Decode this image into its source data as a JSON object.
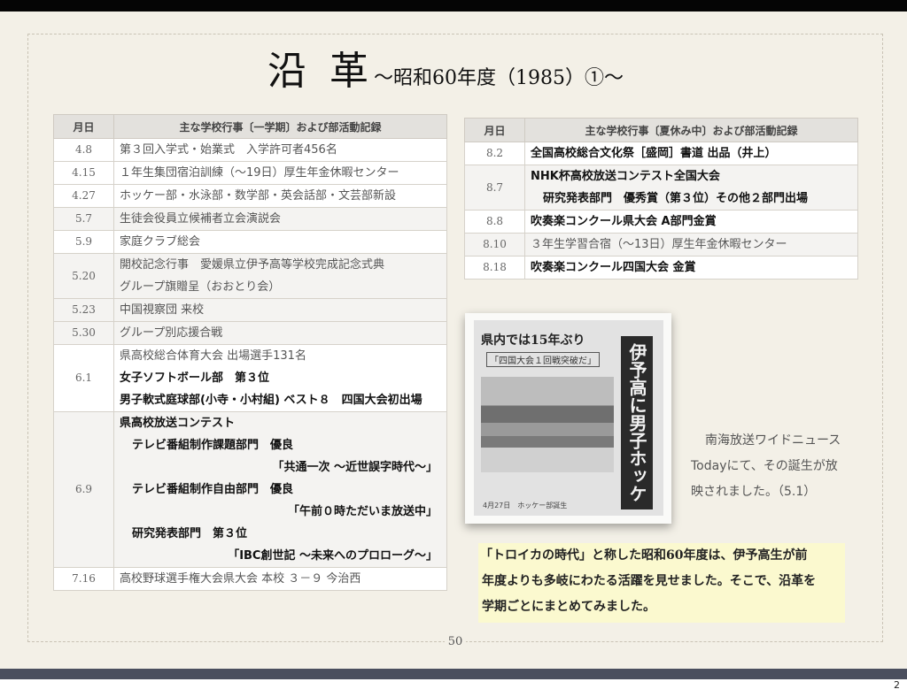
{
  "title": {
    "main": "沿 革",
    "sub": "～昭和60年度（1985）①～"
  },
  "left_table": {
    "headers": [
      "月日",
      "主な学校行事〔一学期〕および部活動記録"
    ],
    "rows": [
      {
        "date": "4.8",
        "shade": false,
        "lines": [
          {
            "text": "第３回入学式・始業式　入学許可者456名"
          }
        ]
      },
      {
        "date": "4.15",
        "shade": false,
        "lines": [
          {
            "text": "１年生集団宿泊訓練（～19日）厚生年金休暇センター"
          }
        ]
      },
      {
        "date": "4.27",
        "shade": false,
        "lines": [
          {
            "text": "ホッケー部・水泳部・数学部・英会話部・文芸部新設"
          }
        ]
      },
      {
        "date": "5.7",
        "shade": true,
        "lines": [
          {
            "text": "生徒会役員立候補者立会演説会"
          }
        ]
      },
      {
        "date": "5.9",
        "shade": false,
        "lines": [
          {
            "text": "家庭クラブ総会"
          }
        ]
      },
      {
        "date": "5.20",
        "shade": true,
        "lines": [
          {
            "text": "開校記念行事　愛媛県立伊予高等学校完成記念式典"
          },
          {
            "text": "グループ旗贈呈（おおとり会）"
          }
        ]
      },
      {
        "date": "5.23",
        "shade": true,
        "lines": [
          {
            "text": "中国視察団 来校"
          }
        ]
      },
      {
        "date": "5.30",
        "shade": true,
        "lines": [
          {
            "text": "グループ別応援合戦"
          }
        ]
      },
      {
        "date": "6.1",
        "shade": false,
        "lines": [
          {
            "text": "県高校総合体育大会 出場選手131名"
          },
          {
            "text": "女子ソフトボール部　第３位",
            "bold": true
          },
          {
            "text": "男子軟式庭球部(小寺・小村組) ベスト８　四国大会初出場",
            "bold": true
          }
        ]
      },
      {
        "date": "6.9",
        "shade": true,
        "lines": [
          {
            "text": "県高校放送コンテスト",
            "bold": true
          },
          {
            "text": "テレビ番組制作課題部門　優良",
            "bold": true,
            "indent": true
          },
          {
            "text": "「共通一次 ～近世誤字時代～」",
            "bold": true,
            "right": true
          },
          {
            "text": "テレビ番組制作自由部門　優良",
            "bold": true,
            "indent": true
          },
          {
            "text": "「午前０時ただいま放送中」",
            "bold": true,
            "right": true
          },
          {
            "text": "研究発表部門　第３位",
            "bold": true,
            "indent": true
          },
          {
            "text": "「IBC創世記 ～未来へのプロローグ～」",
            "bold": true,
            "right": true
          }
        ]
      },
      {
        "date": "7.16",
        "shade": false,
        "lines": [
          {
            "text": "高校野球選手権大会県大会 本校 ３－９ 今治西"
          }
        ]
      }
    ]
  },
  "right_table": {
    "headers": [
      "月日",
      "主な学校行事〔夏休み中〕および部活動記録"
    ],
    "rows": [
      {
        "date": "8.2",
        "shade": false,
        "lines": [
          {
            "text": "全国高校総合文化祭［盛岡］書道 出品（井上）",
            "bold": true
          }
        ]
      },
      {
        "date": "8.7",
        "shade": true,
        "lines": [
          {
            "text": "NHK杯高校放送コンテスト全国大会",
            "bold": true
          },
          {
            "text": "研究発表部門　優秀賞（第３位）その他２部門出場",
            "bold": true,
            "indent": true
          }
        ]
      },
      {
        "date": "8.8",
        "shade": false,
        "lines": [
          {
            "text": "吹奏楽コンクール県大会 A部門金賞",
            "bold": true
          }
        ]
      },
      {
        "date": "8.10",
        "shade": true,
        "lines": [
          {
            "text": "３年生学習合宿（～13日）厚生年金休暇センター"
          }
        ]
      },
      {
        "date": "8.18",
        "shade": false,
        "lines": [
          {
            "text": "吹奏楽コンクール四国大会 金賞",
            "bold": true
          }
        ]
      }
    ]
  },
  "clipping": {
    "headline": "県内では15年ぶり",
    "subhead": "「四国大会１回戦突破だ」",
    "vertical_headline": "伊予高に男子ホッケー部",
    "caption": "4月27日　ホッケー部誕生"
  },
  "photo_note": {
    "lines": [
      "南海放送ワイドニュース",
      "Todayにて、その誕生が放",
      "映されました。（5.1）"
    ]
  },
  "summary": {
    "lines": [
      "「トロイカの時代」と称した昭和60年度は、伊予高生が前",
      "年度よりも多岐にわたる活躍を見せました。そこで、沿革を",
      "学期ごとにまとめてみました。"
    ]
  },
  "page_number": "50",
  "slide_number": "2",
  "colors": {
    "slide_bg": "#f3f0e7",
    "header_bg": "#e3e1dd",
    "summary_bg": "#fbf9cf",
    "bars": "#050505"
  }
}
